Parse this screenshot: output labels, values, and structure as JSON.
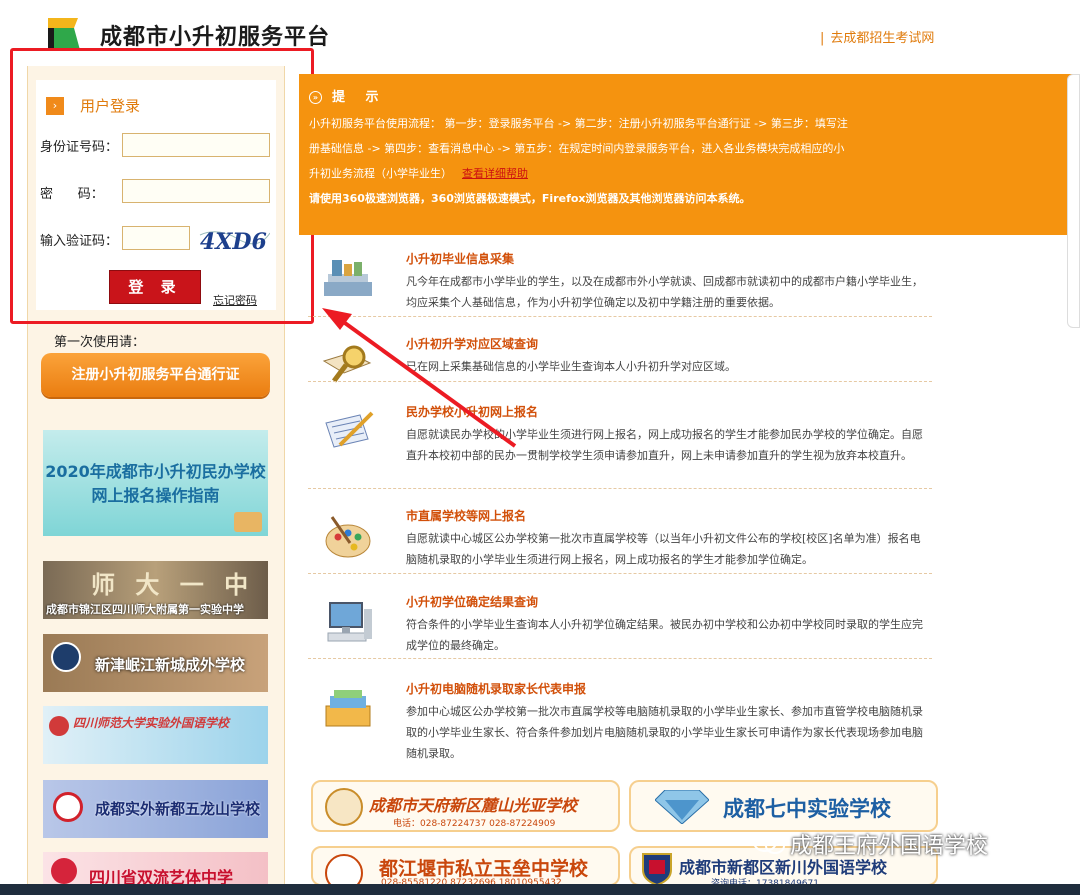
{
  "header": {
    "title": "成都市小升初服务平台",
    "external_link": "去成都招生考试网",
    "logo_icon": "green-yellow-flag-logo"
  },
  "login": {
    "heading": "用户登录",
    "id_label": "身份证号码：",
    "password_label": "密      码：",
    "captcha_label": "输入验证码：",
    "captcha_text": "4XD6",
    "login_button": "登  录",
    "forgot_link": "忘记密码"
  },
  "sidebar": {
    "first_use_label": "第一次使用请：",
    "register_button": "注册小升初服务平台通行证",
    "guide_banner": [
      "2020年成都市小升初民办学校",
      "网上报名操作指南"
    ],
    "school_banners": [
      "成都市锦江区四川师大附属第一实验中学",
      "新津岷江新城成外学校",
      "四川师范大学实验外国语学校",
      "成都实外新都五龙山学校",
      "四川省双流艺体中学"
    ]
  },
  "notice": {
    "title": "提  示",
    "line1": "小升初服务平台使用流程： 第一步：登录服务平台 -> 第二步：注册小升初服务平台通行证 -> 第三步：填写注",
    "line2": "册基础信息 -> 第四步：查看消息中心 -> 第五步：在规定时间内登录服务平台，进入各业务模块完成相应的小",
    "line3": "升初业务流程（小学毕业生）",
    "help_link": "查看详细帮助",
    "browser_warning": "请使用360极速浏览器，360浏览器极速模式，Firefox浏览器及其他浏览器访问本系统。"
  },
  "items": [
    {
      "title": "小升初毕业信息采集",
      "desc": "凡今年在成都市小学毕业的学生，以及在成都市外小学就读、回成都市就读初中的成都市户籍小学毕业生，均应采集个人基础信息，作为小升初学位确定以及初中学籍注册的重要依据。",
      "icon": "books-icon"
    },
    {
      "title": "小升初升学对应区域查询",
      "desc": "已在网上采集基础信息的小学毕业生查询本人小升初升学对应区域。",
      "icon": "magnifier-book-icon"
    },
    {
      "title": "民办学校小升初网上报名",
      "desc": "自愿就读民办学校的小学毕业生须进行网上报名，网上成功报名的学生才能参加民办学校的学位确定。自愿直升本校初中部的民办一贯制学校学生须申请参加直升，网上未申请参加直升的学生视为放弃本校直升。",
      "icon": "notebook-pen-icon"
    },
    {
      "title": "市直属学校等网上报名",
      "desc": "自愿就读中心城区公办学校第一批次市直属学校等（以当年小升初文件公布的学校[校区]名单为准）报名电脑随机录取的小学毕业生须进行网上报名，网上成功报名的学生才能参加学位确定。",
      "icon": "palette-icon"
    },
    {
      "title": "小升初学位确定结果查询",
      "desc": "符合条件的小学毕业生查询本人小升初学位确定结果。被民办初中学校和公办初中学校同时录取的学生应完成学位的最终确定。",
      "icon": "computer-icon"
    },
    {
      "title": "小升初电脑随机录取家长代表申报",
      "desc": "参加中心城区公办学校第一批次市直属学校等电脑随机录取的小学毕业生家长、参加市直管学校电脑随机录取的小学毕业生家长、符合条件参加划片电脑随机录取的小学毕业生家长可申请作为家长代表现场参加电脑随机录取。",
      "icon": "folders-icon"
    }
  ],
  "school_cards": [
    {
      "name": "成都市天府新区麓山光亚学校",
      "sub": "电话：028-87224737  028-87224909"
    },
    {
      "name": "成都七中实验学校",
      "sub": ""
    },
    {
      "name": "都江堰市私立玉垒中学校",
      "sub": "028-85581220 87232696 18010955432"
    },
    {
      "name": "成都市新都区新川外国语学校",
      "sub": "咨询电话：17381849671"
    }
  ],
  "watermark": "成都王府外国语学校",
  "colors": {
    "accent_orange": "#f5930f",
    "login_red": "#c9141a",
    "highlight_frame": "#ec1b23",
    "title_orange": "#d2500a"
  }
}
